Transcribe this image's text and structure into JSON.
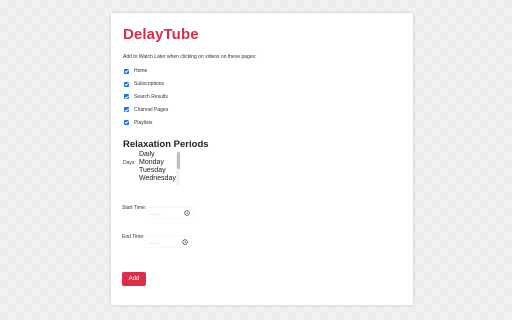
{
  "app": {
    "title": "DelayTube"
  },
  "watch_later": {
    "description": "Add to Watch Later when clicking on videos on these pages:",
    "pages": [
      {
        "label": "Home",
        "checked": true
      },
      {
        "label": "Subscriptions",
        "checked": true
      },
      {
        "label": "Search Results",
        "checked": true
      },
      {
        "label": "Channel Pages",
        "checked": true
      },
      {
        "label": "Playlists",
        "checked": true
      }
    ]
  },
  "relaxation": {
    "title": "Relaxation Periods",
    "days_label": "Days:",
    "days_options": [
      "Daily",
      "Monday",
      "Tuesday",
      "Wednesday"
    ],
    "start_time_label": "Start Time:",
    "start_time_value": "--:-- --",
    "end_time_label": "End Time:",
    "end_time_value": "--:-- --",
    "add_label": "Add"
  },
  "colors": {
    "accent": "#dc2d4a",
    "checkbox": "#1a73e8"
  },
  "icons": {
    "time": "clock-icon"
  }
}
